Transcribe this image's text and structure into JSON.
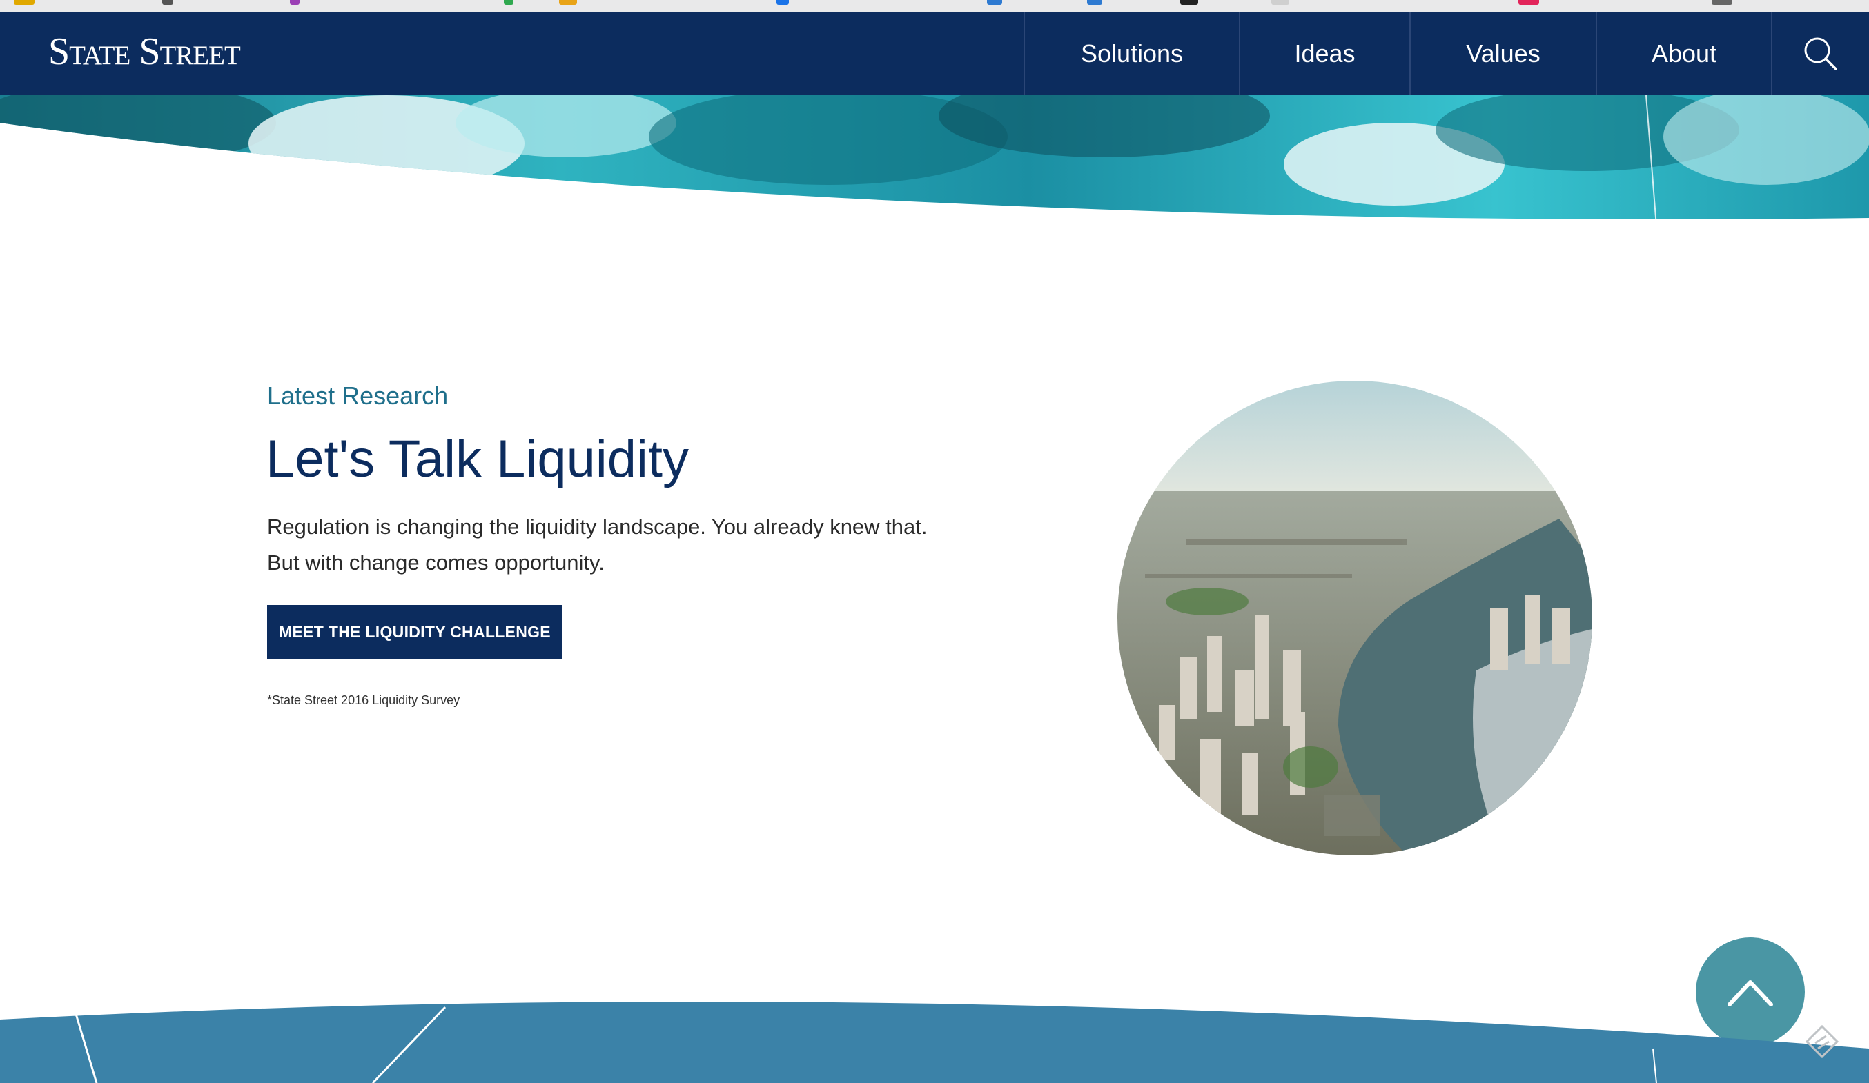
{
  "header": {
    "logo_text": "State Street",
    "nav": [
      {
        "label": "Solutions"
      },
      {
        "label": "Ideas"
      },
      {
        "label": "Values"
      },
      {
        "label": "About"
      }
    ],
    "search_icon": "search-icon"
  },
  "main": {
    "eyebrow": "Latest Research",
    "headline": "Let's Talk Liquidity",
    "body": "Regulation is changing the liquidity landscape. You already knew that. But with change comes opportunity.",
    "cta_label": "MEET THE LIQUIDITY CHALLENGE",
    "footnote": "*State Street 2016 Liquidity Survey"
  },
  "controls": {
    "back_to_top_icon": "chevron-up-icon",
    "feedback_icon": "feedback-icon"
  },
  "colors": {
    "brand_navy": "#0c2c5e",
    "accent_teal": "#1f6f8b",
    "button_teal": "#4a96a4",
    "footer_blue": "#3b82a8"
  }
}
